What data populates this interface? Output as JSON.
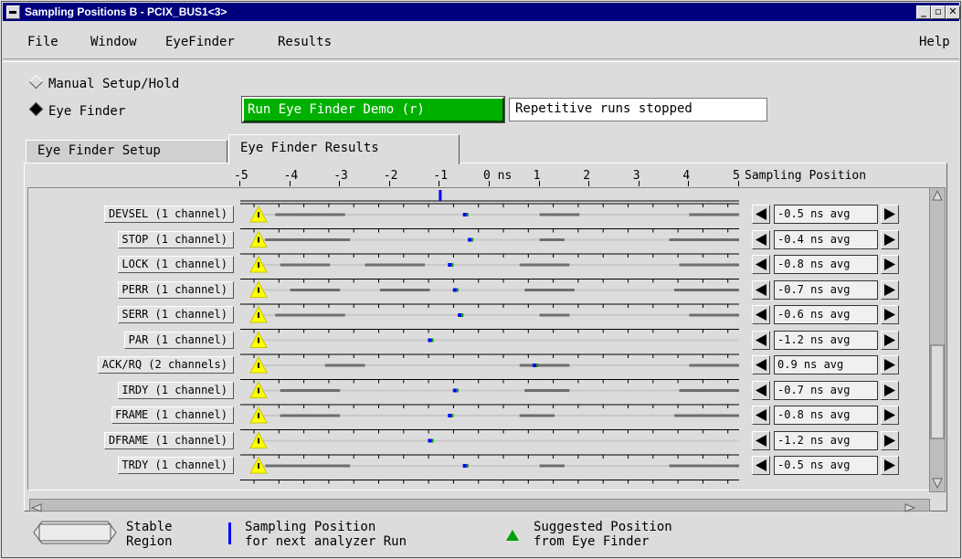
{
  "window": {
    "title": "Sampling Positions B - PCIX_BUS1<3>",
    "controls": [
      "_",
      "▫",
      "✕"
    ]
  },
  "menubar": {
    "file": "File",
    "window": "Window",
    "eyefinder": "EyeFinder",
    "results": "Results",
    "help": "Help"
  },
  "mode": {
    "manual": "Manual Setup/Hold",
    "eye": "Eye Finder",
    "selected": "eye"
  },
  "run_button": "Run Eye Finder Demo (r)",
  "status_text": "Repetitive runs stopped",
  "tabs": {
    "setup": "Eye Finder Setup",
    "results": "Eye Finder Results",
    "active": "results"
  },
  "scale": {
    "ticks": [
      "-5",
      "-4",
      "-3",
      "-2",
      "-1",
      "0 ns",
      "1",
      "2",
      "3",
      "4",
      "5"
    ],
    "values": [
      -5,
      -4,
      -3,
      -2,
      -1,
      0,
      1,
      2,
      3,
      4,
      5
    ],
    "header": "Sampling Position",
    "global_marker_ns": -1.0
  },
  "signals": [
    {
      "label": "DEVSEL (1 channel)",
      "position": "-0.5 ns avg",
      "marker_ns": -0.5,
      "stable": [
        [
          -4.3,
          -2.9
        ],
        [
          1.0,
          1.8
        ],
        [
          4.0,
          5.0
        ]
      ]
    },
    {
      "label": "STOP (1 channel)",
      "position": "-0.4 ns avg",
      "marker_ns": -0.4,
      "stable": [
        [
          -4.5,
          -2.8
        ],
        [
          1.0,
          1.5
        ],
        [
          3.6,
          5.0
        ]
      ]
    },
    {
      "label": "LOCK (1 channel)",
      "position": "-0.8 ns avg",
      "marker_ns": -0.8,
      "stable": [
        [
          -4.2,
          -3.2
        ],
        [
          -2.5,
          -1.3
        ],
        [
          0.6,
          1.6
        ],
        [
          3.8,
          5.0
        ]
      ]
    },
    {
      "label": "PERR (1 channel)",
      "position": "-0.7 ns avg",
      "marker_ns": -0.7,
      "stable": [
        [
          -4.0,
          -3.0
        ],
        [
          -2.2,
          -1.2
        ],
        [
          0.7,
          1.7
        ],
        [
          3.7,
          5.0
        ]
      ]
    },
    {
      "label": "SERR (1 channel)",
      "position": "-0.6 ns avg",
      "marker_ns": -0.6,
      "stable": [
        [
          -4.3,
          -2.9
        ],
        [
          1.0,
          1.6
        ],
        [
          4.0,
          5.0
        ]
      ]
    },
    {
      "label": "PAR (1 channel)",
      "position": "-1.2 ns avg",
      "marker_ns": -1.2,
      "stable": []
    },
    {
      "label": "ACK/RQ (2 channels)",
      "position": "0.9 ns avg",
      "marker_ns": 0.9,
      "stable": [
        [
          -3.3,
          -2.5
        ],
        [
          0.6,
          1.6
        ],
        [
          4.0,
          5.0
        ]
      ]
    },
    {
      "label": "IRDY (1 channel)",
      "position": "-0.7 ns avg",
      "marker_ns": -0.7,
      "stable": [
        [
          -4.2,
          -3.0
        ],
        [
          0.7,
          1.6
        ],
        [
          3.8,
          5.0
        ]
      ]
    },
    {
      "label": "FRAME (1 channel)",
      "position": "-0.8 ns avg",
      "marker_ns": -0.8,
      "stable": [
        [
          -4.2,
          -3.0
        ],
        [
          0.6,
          1.3
        ],
        [
          3.7,
          5.0
        ]
      ]
    },
    {
      "label": "DFRAME (1 channel)",
      "position": "-1.2 ns avg",
      "marker_ns": -1.2,
      "stable": []
    },
    {
      "label": "TRDY (1 channel)",
      "position": "-0.5 ns avg",
      "marker_ns": -0.5,
      "stable": [
        [
          -4.5,
          -2.8
        ],
        [
          1.0,
          1.5
        ],
        [
          3.6,
          5.0
        ]
      ]
    }
  ],
  "legend": {
    "stable_l1": "Stable",
    "stable_l2": "Region",
    "sampling_l1": "Sampling Position",
    "sampling_l2": "for next analyzer Run",
    "suggested_l1": "Suggested Position",
    "suggested_l2": "from Eye Finder"
  },
  "colors": {
    "titlebar": "#00007f",
    "run_button": "#00b000",
    "sampling_marker": "#0000ff",
    "suggested_marker": "#00a000",
    "warning_icon": "#ffff00",
    "stable_bar": "#6e6e6e"
  }
}
